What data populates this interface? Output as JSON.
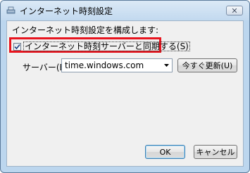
{
  "window": {
    "title": "インターネット時刻設定",
    "close_glyph": "✕"
  },
  "content": {
    "heading": "インターネット時刻設定を構成します:",
    "sync_checkbox": {
      "label": "インターネット時刻サーバーと同期する(S)",
      "checked": true
    },
    "server": {
      "label": "サーバー(E):",
      "value": "time.windows.com"
    },
    "update_button": "今すぐ更新(U)"
  },
  "footer": {
    "ok_label": "OK",
    "cancel_label": "キャンセル"
  },
  "colors": {
    "highlight": "#e8141e",
    "title_bar": "#c2d9ef"
  }
}
